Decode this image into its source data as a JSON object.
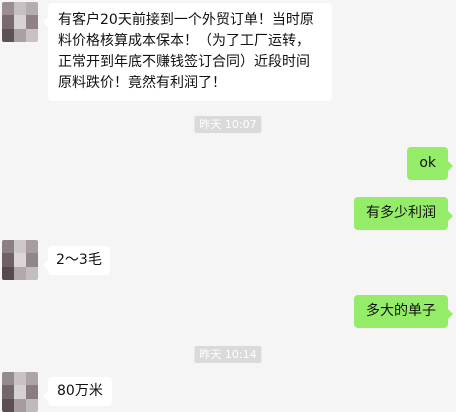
{
  "messages": {
    "m1": "有客户20天前接到一个外贸订单！当时原料价格核算成本保本！（为了工厂运转，正常开到年底不赚钱签订合同）近段时间原料跌价！竟然有利润了！",
    "t1": "昨天 10:07",
    "m2": "ok",
    "m3": "有多少利润",
    "m4": "2～3毛",
    "m5": "多大的单子",
    "t2": "昨天 10:14",
    "m6": "80万米"
  },
  "colors": {
    "background": "#f5f5f5",
    "incoming_bubble": "#ffffff",
    "outgoing_bubble": "#95ec69",
    "timestamp_bg": "#dadada"
  }
}
